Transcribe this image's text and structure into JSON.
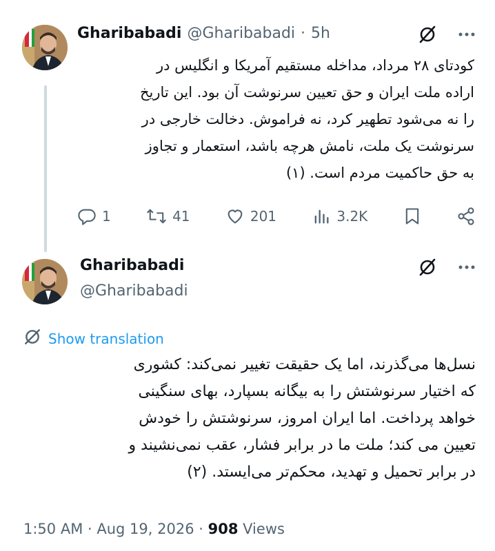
{
  "tweet1": {
    "author_name": "Gharibabadi",
    "author_handle": "@Gharibabadi",
    "separator": "·",
    "time_ago": "5h",
    "text": "کودتای ۲۸ مرداد، مداخله مستقیم آمریکا و انگلیس در\nاراده ملت ایران و حق تعیین سرنوشت آن بود. این تاریخ\nرا نه می‌شود تطهیر کرد، نه فراموش. دخالت خارجی در\nسرنوشت یک ملت، نامش هرچه باشد، استعمار و تجاوز\nبه حق حاکمیت مردم است. (۱)",
    "replies": "1",
    "retweets": "41",
    "likes": "201",
    "views": "3.2K"
  },
  "tweet2": {
    "author_name": "Gharibabadi",
    "author_handle": "@Gharibabadi",
    "show_translation": "Show translation",
    "text": "نسل‌ها می‌گذرند، اما یک حقیقت تغییر نمی‌کند: کشوری\nکه اختیار سرنوشتش را به بیگانه بسپارد، بهای سنگینی\nخواهد پرداخت. اما ایران امروز، سرنوشتش را خودش\nتعیین می کند؛ ملت ما در برابر فشار، عقب نمی‌نشیند و\nدر برابر تحمیل و تهدید، محکم‌تر می‌ایستد. (۲)",
    "time": "1:50 AM",
    "date": "Aug 19, 2026",
    "views_count": "908",
    "views_label": "Views"
  },
  "colors": {
    "text_primary": "#0f1419",
    "text_secondary": "#536471",
    "link_blue": "#1d9bf0",
    "thread_line": "#cfd9de"
  },
  "icons": [
    "grok-icon",
    "more-icon",
    "reply-icon",
    "retweet-icon",
    "like-icon",
    "views-icon",
    "bookmark-icon",
    "share-icon",
    "translate-icon"
  ]
}
